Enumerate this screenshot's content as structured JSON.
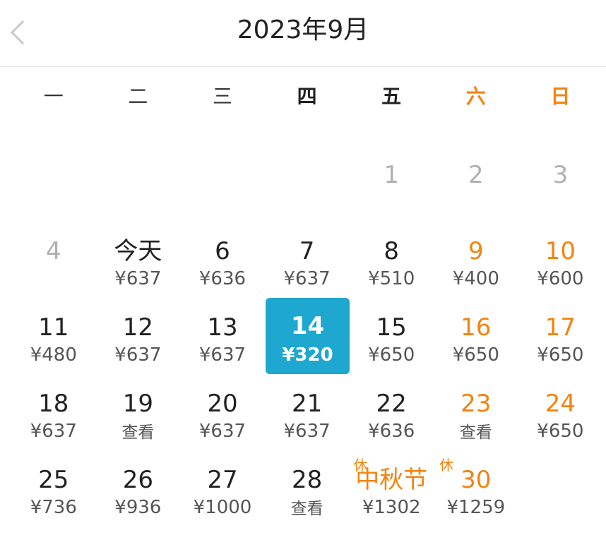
{
  "header": {
    "title": "2023年9月"
  },
  "weekdays": [
    "一",
    "二",
    "三",
    "四",
    "五",
    "六",
    "日"
  ],
  "days": {
    "d1": {
      "day": "1"
    },
    "d2": {
      "day": "2"
    },
    "d3": {
      "day": "3"
    },
    "d4": {
      "day": "4"
    },
    "d5": {
      "day": "今天",
      "price": "¥637"
    },
    "d6": {
      "day": "6",
      "price": "¥636"
    },
    "d7": {
      "day": "7",
      "price": "¥637"
    },
    "d8": {
      "day": "8",
      "price": "¥510"
    },
    "d9": {
      "day": "9",
      "price": "¥400"
    },
    "d10": {
      "day": "10",
      "price": "¥600"
    },
    "d11": {
      "day": "11",
      "price": "¥480"
    },
    "d12": {
      "day": "12",
      "price": "¥637"
    },
    "d13": {
      "day": "13",
      "price": "¥637"
    },
    "d14": {
      "day": "14",
      "price": "¥320"
    },
    "d15": {
      "day": "15",
      "price": "¥650"
    },
    "d16": {
      "day": "16",
      "price": "¥650"
    },
    "d17": {
      "day": "17",
      "price": "¥650"
    },
    "d18": {
      "day": "18",
      "price": "¥637"
    },
    "d19": {
      "day": "19",
      "price": "查看"
    },
    "d20": {
      "day": "20",
      "price": "¥637"
    },
    "d21": {
      "day": "21",
      "price": "¥637"
    },
    "d22": {
      "day": "22",
      "price": "¥636"
    },
    "d23": {
      "day": "23",
      "price": "查看"
    },
    "d24": {
      "day": "24",
      "price": "¥650"
    },
    "d25": {
      "day": "25",
      "price": "¥736"
    },
    "d26": {
      "day": "26",
      "price": "¥936"
    },
    "d27": {
      "day": "27",
      "price": "¥1000"
    },
    "d28": {
      "day": "28",
      "price": "查看"
    },
    "d29": {
      "day": "中秋节",
      "price": "¥1302",
      "badge": "休"
    },
    "d30": {
      "day": "30",
      "price": "¥1259",
      "badge": "休"
    }
  },
  "colors": {
    "accent": "#1ea7cf",
    "weekend": "#f2840f"
  },
  "icons": {
    "back": "chevron-left-icon"
  }
}
